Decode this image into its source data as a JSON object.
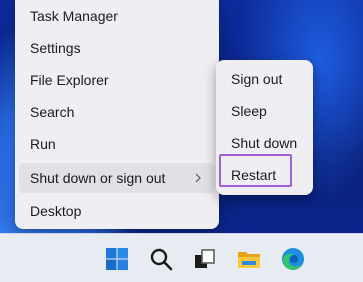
{
  "start_menu": {
    "items": [
      {
        "label": "Task Manager"
      },
      {
        "label": "Settings"
      },
      {
        "label": "File Explorer"
      },
      {
        "label": "Search"
      },
      {
        "label": "Run"
      },
      {
        "label": "Shut down or sign out",
        "highlighted": true,
        "has_submenu": true
      },
      {
        "label": "Desktop"
      }
    ]
  },
  "submenu": {
    "items": [
      {
        "label": "Sign out"
      },
      {
        "label": "Sleep"
      },
      {
        "label": "Shut down"
      },
      {
        "label": "Restart",
        "highlighted_outline": true
      }
    ]
  },
  "taskbar": {
    "icons": [
      "windows-start-icon",
      "search-icon",
      "task-view-icon",
      "file-explorer-icon",
      "edge-browser-icon"
    ]
  },
  "colors": {
    "menu_bg": "#efeef3",
    "highlight_bg": "#e1e0e7",
    "outline_accent": "#a25fd6",
    "taskbar_bg": "#e7ebf2",
    "desktop_blue": "#0c2c9e"
  }
}
